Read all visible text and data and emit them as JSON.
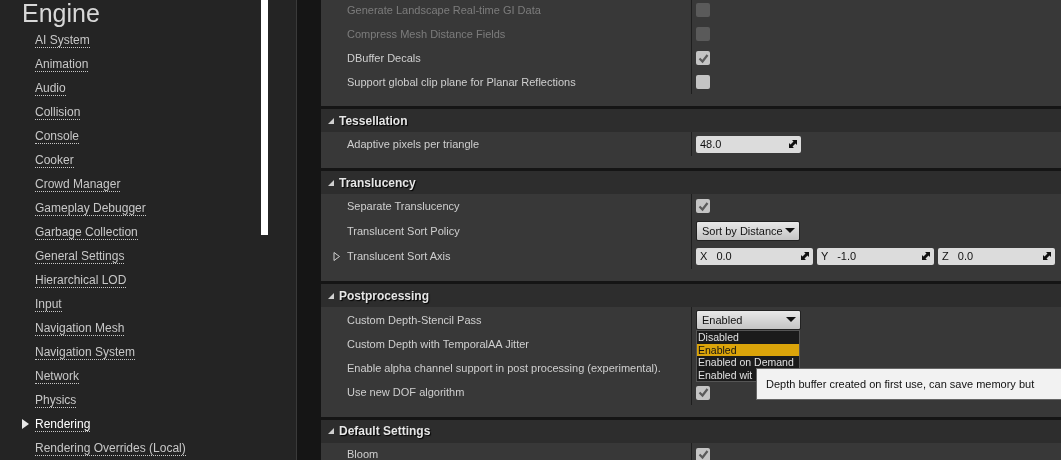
{
  "sidebar": {
    "title": "Engine",
    "items": [
      {
        "label": "AI System",
        "selected": false
      },
      {
        "label": "Animation",
        "selected": false
      },
      {
        "label": "Audio",
        "selected": false
      },
      {
        "label": "Collision",
        "selected": false
      },
      {
        "label": "Console",
        "selected": false
      },
      {
        "label": "Cooker",
        "selected": false
      },
      {
        "label": "Crowd Manager",
        "selected": false
      },
      {
        "label": "Gameplay Debugger",
        "selected": false
      },
      {
        "label": "Garbage Collection",
        "selected": false
      },
      {
        "label": "General Settings",
        "selected": false
      },
      {
        "label": "Hierarchical LOD",
        "selected": false
      },
      {
        "label": "Input",
        "selected": false
      },
      {
        "label": "Navigation Mesh",
        "selected": false
      },
      {
        "label": "Navigation System",
        "selected": false
      },
      {
        "label": "Network",
        "selected": false
      },
      {
        "label": "Physics",
        "selected": false
      },
      {
        "label": "Rendering",
        "selected": true
      },
      {
        "label": "Rendering Overrides (Local)",
        "selected": false
      }
    ]
  },
  "sections": [
    {
      "rows": [
        {
          "kind": "checkbox",
          "label": "Generate Landscape Real-time GI Data",
          "disabled": true,
          "checked": false
        },
        {
          "kind": "checkbox",
          "label": "Compress Mesh Distance Fields",
          "disabled": true,
          "checked": false
        },
        {
          "kind": "checkbox",
          "label": "DBuffer Decals",
          "disabled": false,
          "checked": true
        },
        {
          "kind": "checkbox",
          "label": "Support global clip plane for Planar Reflections",
          "disabled": false,
          "checked": false
        }
      ]
    },
    {
      "title": "Tessellation",
      "expanded": true,
      "rows": [
        {
          "kind": "number",
          "label": "Adaptive pixels per triangle",
          "value": "48.0"
        }
      ]
    },
    {
      "title": "Translucency",
      "expanded": true,
      "rows": [
        {
          "kind": "checkbox",
          "label": "Separate Translucency",
          "disabled": false,
          "checked": true
        },
        {
          "kind": "dropdown",
          "label": "Translucent Sort Policy",
          "value": "Sort by Distance"
        },
        {
          "kind": "vector",
          "label": "Translucent Sort Axis",
          "expanded": false,
          "components": [
            {
              "axis": "X",
              "value": "0.0"
            },
            {
              "axis": "Y",
              "value": "-1.0"
            },
            {
              "axis": "Z",
              "value": "0.0"
            }
          ]
        }
      ]
    },
    {
      "title": "Postprocessing",
      "expanded": true,
      "rows": [
        {
          "kind": "dropdown",
          "label": "Custom Depth-Stencil Pass",
          "value": "Enabled",
          "options": [
            {
              "label": "Disabled",
              "selected": false
            },
            {
              "label": "Enabled",
              "selected": true
            },
            {
              "label": "Enabled on Demand",
              "selected": false
            },
            {
              "label": "Enabled wit",
              "selected": false
            }
          ]
        },
        {
          "kind": "text",
          "label": "Custom Depth with TemporalAA Jitter"
        },
        {
          "kind": "text",
          "label": "Enable alpha channel support in post processing (experimental)."
        },
        {
          "kind": "checkbox",
          "label": "Use new DOF algorithm",
          "disabled": false,
          "checked": true
        }
      ]
    },
    {
      "title": "Default Settings",
      "expanded": true,
      "rows": [
        {
          "kind": "checkbox",
          "label": "Bloom",
          "disabled": false,
          "checked": true
        }
      ]
    }
  ],
  "tooltip": {
    "text": "Depth buffer created on first use, can save memory but"
  }
}
